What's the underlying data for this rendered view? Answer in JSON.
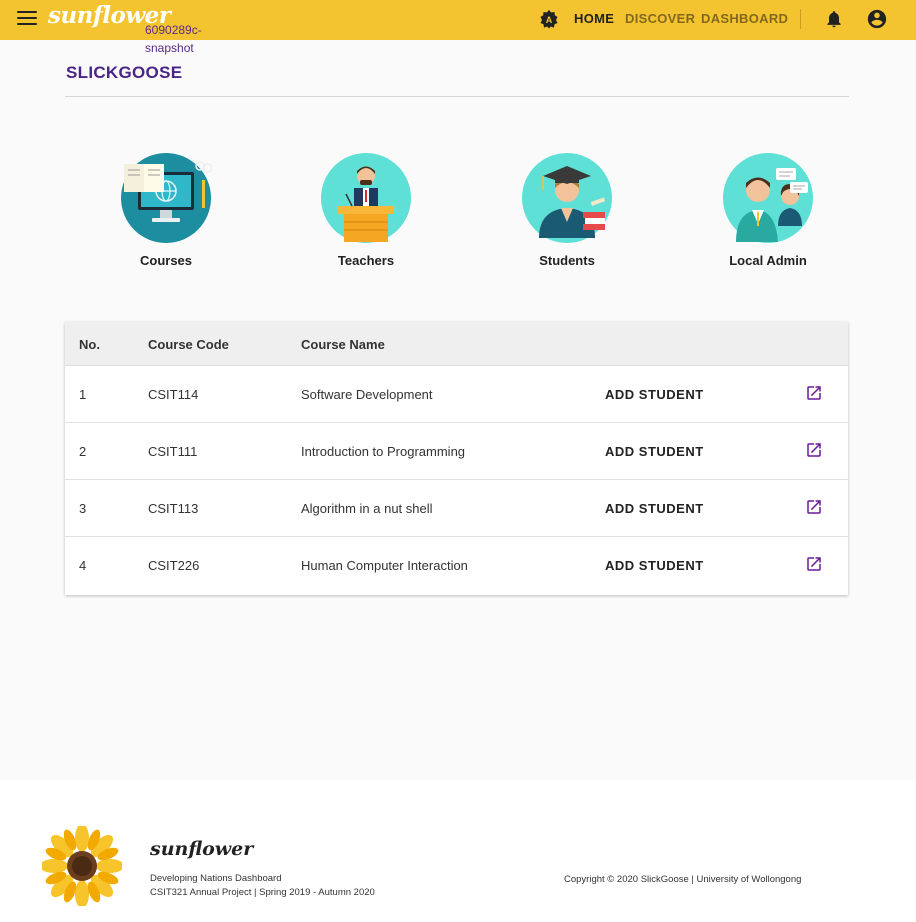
{
  "header": {
    "brand": "sunflower",
    "snapshot_label": "6090289c-snapshot",
    "nav": {
      "home": "HOME",
      "discover": "DISCOVER",
      "dashboard": "DASHBOARD"
    },
    "accent_color": "#f4c430"
  },
  "page": {
    "title": "SLICKGOOSE",
    "title_color": "#4a2585"
  },
  "categories": [
    {
      "label": "Courses",
      "icon": "computer-book-icon"
    },
    {
      "label": "Teachers",
      "icon": "teacher-podium-icon"
    },
    {
      "label": "Students",
      "icon": "graduate-student-icon"
    },
    {
      "label": "Local Admin",
      "icon": "admin-people-icon"
    }
  ],
  "table": {
    "headers": [
      "No.",
      "Course Code",
      "Course Name"
    ],
    "action_label": "ADD STUDENT",
    "rows": [
      {
        "no": "1",
        "code": "CSIT114",
        "name": "Software Development"
      },
      {
        "no": "2",
        "code": "CSIT111",
        "name": "Introduction to Programming"
      },
      {
        "no": "3",
        "code": "CSIT113",
        "name": "Algorithm in a nut shell"
      },
      {
        "no": "4",
        "code": "CSIT226",
        "name": "Human Computer Interaction"
      }
    ]
  },
  "footer": {
    "brand": "sunflower",
    "line1": "Developing Nations Dashboard",
    "line2": "CSIT321 Annual Project | Spring 2019 - Autumn 2020",
    "copyright": "Copyright © 2020 SlickGoose | University of Wollongong"
  }
}
